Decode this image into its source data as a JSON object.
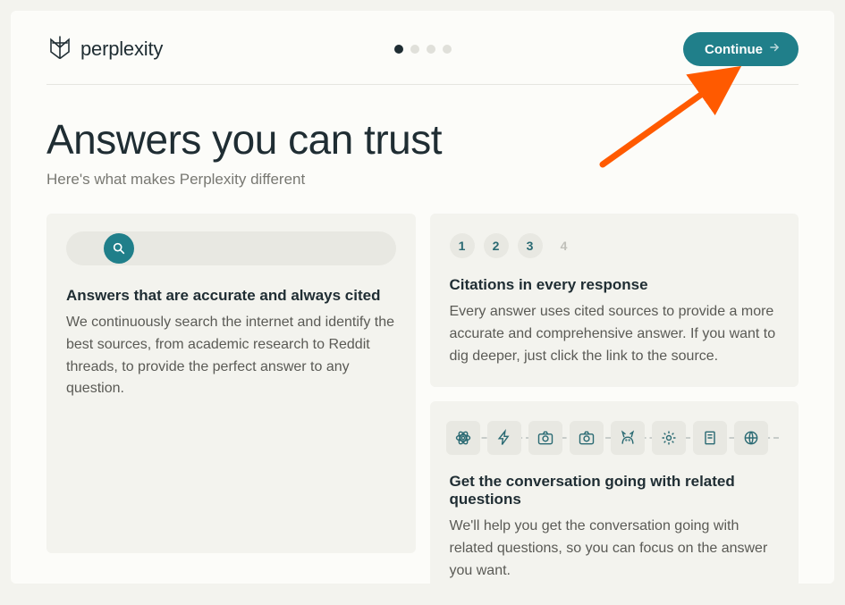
{
  "brand": {
    "name": "perplexity"
  },
  "progress": {
    "total": 4,
    "current": 1
  },
  "continue_label": "Continue",
  "hero": {
    "title": "Answers you can trust",
    "subtitle": "Here's what makes Perplexity different"
  },
  "cards": {
    "accurate": {
      "title": "Answers that are accurate and always cited",
      "desc": "We continuously search the internet and identify the best sources, from academic research to Reddit threads, to provide the perfect answer to any question."
    },
    "citations": {
      "title": "Citations in every response",
      "desc": "Every answer uses cited sources to provide a more accurate and comprehensive answer. If you want to dig deeper, just click the link to the source.",
      "chips": [
        "1",
        "2",
        "3",
        "4"
      ]
    },
    "related": {
      "title": "Get the conversation going with related questions",
      "desc": "We'll help you get the conversation going with related questions, so you can focus on the answer you want."
    }
  }
}
